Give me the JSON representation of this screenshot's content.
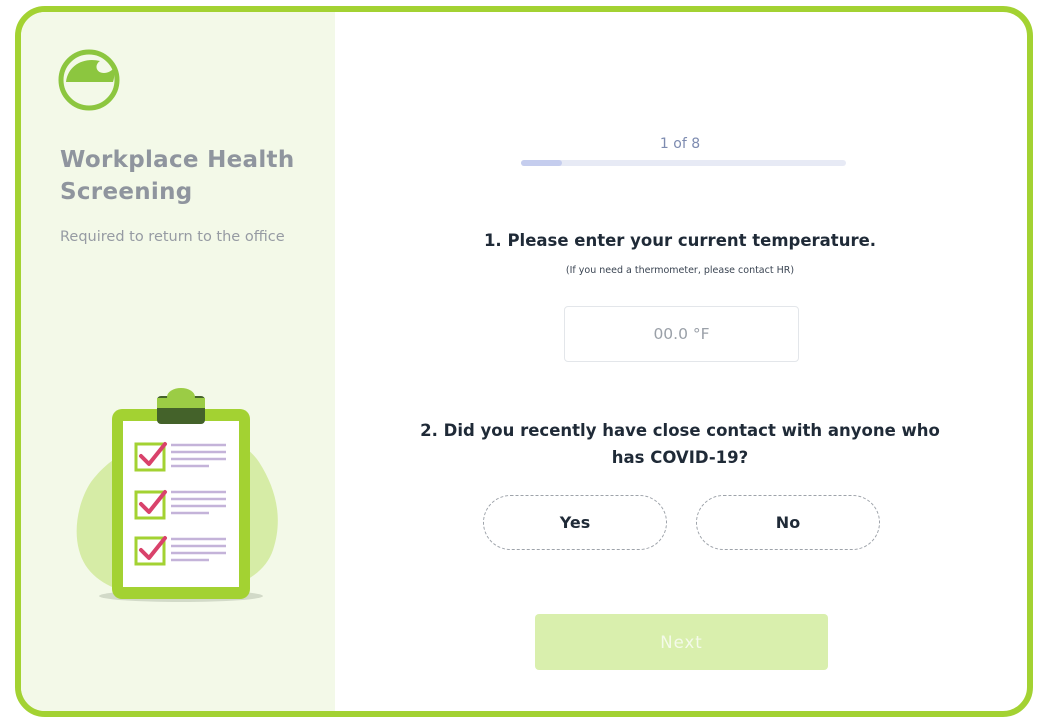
{
  "brand": {
    "title": "Workplace Health Screening",
    "subtitle": "Required to return to the office",
    "logo_icon": "leaf-logo-icon",
    "illustration": "clipboard-checklist-illustration",
    "accent_color": "#a3d232"
  },
  "progress": {
    "label": "1 of 8",
    "current": 1,
    "total": 8
  },
  "question1": {
    "text": "1. Please enter your current temperature.",
    "note": "(If you need a thermometer, please contact HR)",
    "input_placeholder": "00.0 °F",
    "input_value": ""
  },
  "question2": {
    "text": "2. Did you recently have close contact with anyone who has COVID-19?",
    "options": [
      "Yes",
      "No"
    ]
  },
  "actions": {
    "next_label": "Next"
  }
}
